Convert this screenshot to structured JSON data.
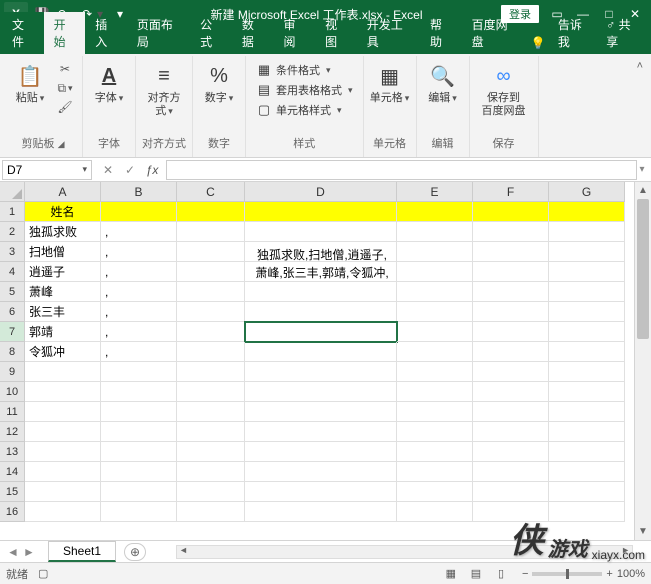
{
  "title": "新建 Microsoft Excel 工作表.xlsx - Excel",
  "login": "登录",
  "tabs": {
    "file": "文件",
    "home": "开始",
    "insert": "插入",
    "layout": "页面布局",
    "formula": "公式",
    "data": "数据",
    "review": "审阅",
    "view": "视图",
    "dev": "开发工具",
    "help": "帮助",
    "baidu": "百度网盘",
    "tell": "告诉我",
    "share": "共享"
  },
  "ribbon": {
    "clipboard": {
      "paste": "粘贴",
      "label": "剪贴板"
    },
    "font": {
      "btn": "字体",
      "label": "字体"
    },
    "align": {
      "btn": "对齐方式",
      "label": "对齐方式"
    },
    "number": {
      "btn": "数字",
      "label": "数字"
    },
    "styles": {
      "cond": "条件格式",
      "tbl": "套用表格格式",
      "cell": "单元格样式",
      "label": "样式"
    },
    "cells": {
      "btn": "单元格",
      "label": "单元格"
    },
    "editing": {
      "btn": "编辑",
      "label": "编辑"
    },
    "save": {
      "btn": "保存到\n百度网盘",
      "label": "保存"
    }
  },
  "namebox": "D7",
  "columns": [
    "A",
    "B",
    "C",
    "D",
    "E",
    "F",
    "G"
  ],
  "row1Header": "姓名",
  "names": [
    "独孤求败",
    "扫地僧",
    "逍遥子",
    "萧峰",
    "张三丰",
    "郭靖",
    "令狐冲"
  ],
  "comma": ",",
  "floatText": "独孤求败,扫地僧,逍遥子,萧峰,张三丰,郭靖,令狐冲,",
  "sheet": "Sheet1",
  "status": {
    "ready": "就绪",
    "zoom": "100%"
  },
  "watermark": {
    "brand": "侠",
    "sub": "游戏",
    "url": "xiayx.com"
  }
}
